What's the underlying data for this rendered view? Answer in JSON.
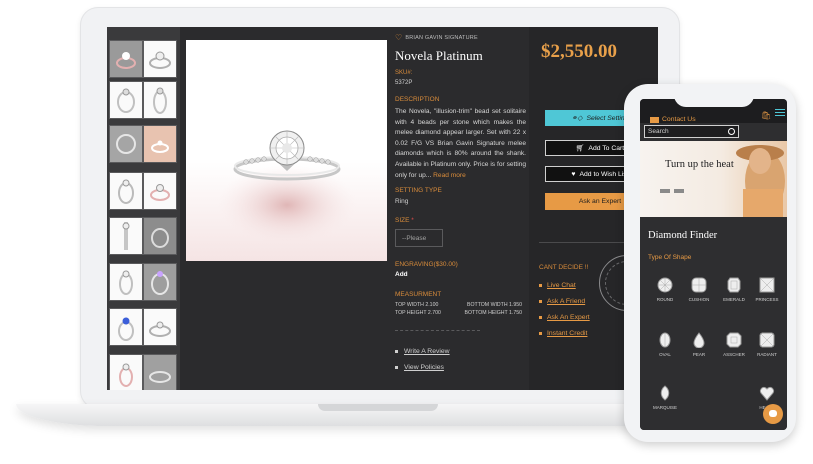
{
  "laptop": {
    "brand": "BRIAN GAVIN SIGNATURE",
    "product": {
      "title": "Novela Platinum",
      "sku_label": "SKU#:",
      "sku_value": "5372P",
      "description_label": "DESCRIPTION",
      "description_text": "The Novela, \"illusion-trim\" bead set solitaire with 4 beads per stone which makes the melee diamond appear larger. Set with 22 x 0.02 F/G VS Brian Gavin Signature melee diamonds which is 80% around the shank. Available in Platinum only. Price is for setting only for up...",
      "read_more": "Read more",
      "setting_type_label": "SETTING TYPE",
      "setting_type_value": "Ring",
      "size_label": "SIZE",
      "size_required": "*",
      "size_placeholder": "--Please",
      "engraving_label": "ENGRAVING($30.00)",
      "engraving_action": "Add",
      "measurement_label": "MEASURMENT",
      "measurements": {
        "top_width": "TOP WIDTH 2.100",
        "bottom_width": "BOTTOM WIDTH 1.950",
        "top_height": "TOP HEIGHT 2.700",
        "bottom_height": "BOTTOM HEIGHT 1.750"
      },
      "links": [
        "Write A Review",
        "View Policies"
      ]
    },
    "purchase": {
      "price": "$2,550.00",
      "select_setting": "Select Setting",
      "add_to_cart": "Add To Cart",
      "add_to_wishlist": "Add to Wish List",
      "ask_expert": "Ask an Expert",
      "cant_decide_label": "CANT DECIDE !!",
      "help_links": [
        "Live Chat",
        "Ask A Friend",
        "Ask An Expert",
        "Instant Credit"
      ]
    },
    "thumbnail_count": 16
  },
  "phone": {
    "contact_label": "Contact Us",
    "search_placeholder": "Search",
    "banner_title": "Turn up the heat",
    "finder_title": "Diamond Finder",
    "shape_section_label": "Type Of Shape",
    "shapes": [
      "ROUND",
      "CUSHION",
      "EMERALD",
      "PRINCESS",
      "OVAL",
      "PEAR",
      "ASSCHER",
      "RADIANT",
      "MARQUISE",
      "HEART"
    ]
  },
  "colors": {
    "accent_orange": "#e79a45",
    "accent_cyan": "#4fc7d6",
    "dark_bg": "#2b2b2d",
    "price_color": "#e8a04a"
  }
}
